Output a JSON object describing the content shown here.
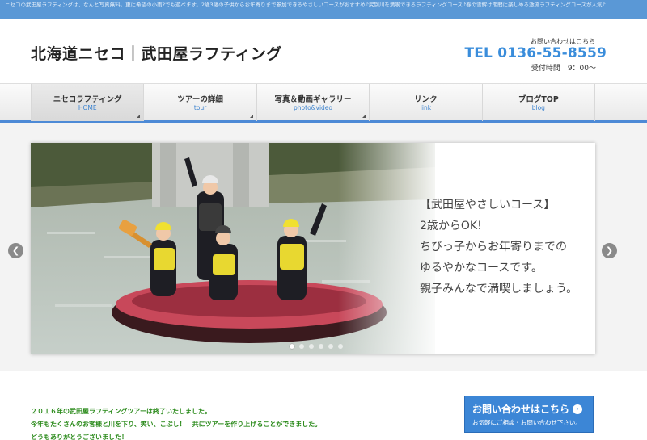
{
  "topbar": {
    "text": "ニセコの武田屋ラフティングは、なんと写真無料。更に希望の小雨?でも遊べます。2歳3歳の子供からお年寄りまで参加できるやさしいコースがおすすめ♪尻別川を満喫できるラフティングコース♪春の雪解け期間に楽しめる激流ラフティングコースが人気♪"
  },
  "header": {
    "title": "北海道ニセコ｜武田屋ラフティング",
    "contact_label": "お問い合わせはこちら",
    "tel": "TEL 0136-55-8559",
    "hours": "受付時間　9：00〜"
  },
  "nav": [
    {
      "jp": "ニセコラフティング",
      "en": "HOME"
    },
    {
      "jp": "ツアーの詳細",
      "en": "tour"
    },
    {
      "jp": "写真＆動画ギャラリー",
      "en": "photo&video"
    },
    {
      "jp": "リンク",
      "en": "link"
    },
    {
      "jp": "ブログTOP",
      "en": "blog"
    }
  ],
  "slider": {
    "lines": [
      "【武田屋やさしいコース】",
      "2歳からOK!",
      "ちびっ子からお年寄りまでの",
      "ゆるやかなコースです。",
      "親子みんなで満喫しましょう。"
    ],
    "prev_icon": "chevron-left-icon",
    "next_icon": "chevron-right-icon",
    "prev_glyph": "❮",
    "next_glyph": "❯",
    "active_dot": 0
  },
  "notice": {
    "lines": [
      "２０１６年の武田屋ラフティングツアーは終了いたしました。",
      "今年もたくさんのお客様と川を下り、笑い、こぶし！　共にツアーを作り上げることができました。",
      "どうもありがとうございました！"
    ]
  },
  "contact_button": {
    "title": "お問い合わせはこちら",
    "subtitle": "お気軽にご相談・お問い合わせ下さい。",
    "icon": "arrow-right-circle-icon",
    "icon_glyph": "›"
  },
  "colors": {
    "accent": "#3c86d6",
    "topbar": "#5a98d6",
    "notice_text": "#2a8a1a"
  }
}
